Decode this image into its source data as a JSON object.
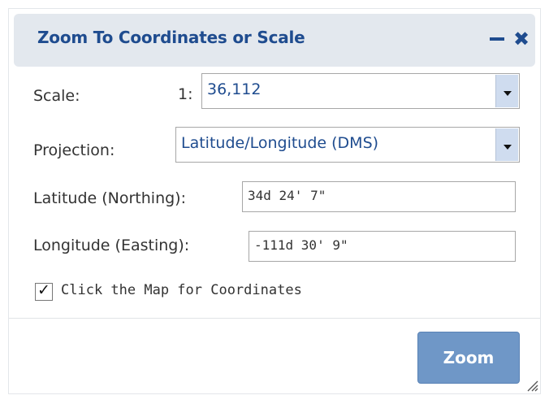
{
  "dialog": {
    "title": "Zoom To Coordinates or Scale",
    "minimize_icon": "minimize-icon",
    "close_icon": "close-icon",
    "close_glyph": "✖"
  },
  "scale": {
    "label": "Scale:",
    "prefix": "1:",
    "value": "36,112"
  },
  "projection": {
    "label": "Projection:",
    "value": "Latitude/Longitude (DMS)"
  },
  "latitude": {
    "label": "Latitude (Northing):",
    "value": "34d 24' 7\""
  },
  "longitude": {
    "label": "Longitude (Easting):",
    "value": "-111d 30' 9\""
  },
  "click_map": {
    "checked": true,
    "check_glyph": "✓",
    "label": "Click the Map for Coordinates"
  },
  "actions": {
    "zoom_label": "Zoom"
  },
  "colors": {
    "accent": "#1f4c8f",
    "titlebar_bg": "#e3e8ee",
    "button_bg": "#6f97c7"
  }
}
